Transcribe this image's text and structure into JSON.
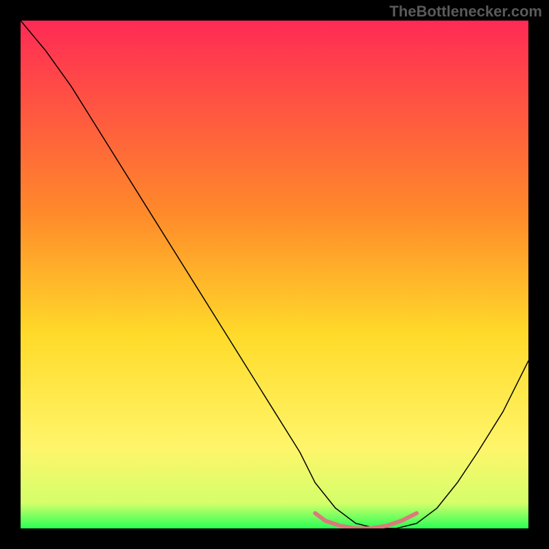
{
  "watermark": "TheBottlenecker.com",
  "chart_data": {
    "type": "line",
    "title": "",
    "xlabel": "",
    "ylabel": "",
    "xlim": [
      0,
      100
    ],
    "ylim": [
      0,
      100
    ],
    "background": {
      "type": "vertical-gradient",
      "stops": [
        {
          "offset": 0,
          "color": "#ff2a55"
        },
        {
          "offset": 38,
          "color": "#ff8a2a"
        },
        {
          "offset": 62,
          "color": "#ffdb2a"
        },
        {
          "offset": 84,
          "color": "#fff56a"
        },
        {
          "offset": 95,
          "color": "#d4ff6a"
        },
        {
          "offset": 100,
          "color": "#2aff55"
        }
      ]
    },
    "series": [
      {
        "name": "curve",
        "color": "#000000",
        "stroke_width": 1.5,
        "x": [
          0,
          5,
          10,
          15,
          20,
          25,
          30,
          35,
          40,
          45,
          50,
          55,
          58,
          62,
          66,
          70,
          74,
          78,
          82,
          86,
          90,
          95,
          100
        ],
        "y": [
          100,
          94,
          87,
          79,
          71,
          63,
          55,
          47,
          39,
          31,
          23,
          15,
          9,
          4,
          1,
          0,
          0,
          1,
          4,
          9,
          15,
          23,
          33
        ]
      },
      {
        "name": "marker-band",
        "color": "#d97b7b",
        "stroke_width": 6,
        "x": [
          58,
          60,
          63,
          66,
          69,
          72,
          75,
          78
        ],
        "y": [
          3.0,
          1.5,
          0.5,
          0.0,
          0.0,
          0.5,
          1.5,
          3.0
        ]
      }
    ]
  }
}
